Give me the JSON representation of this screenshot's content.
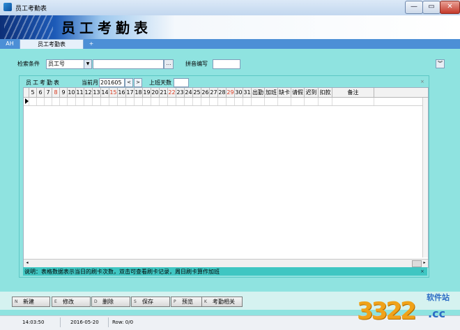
{
  "window": {
    "title": "员工考勤表",
    "min": "—",
    "max": "▭",
    "close": "✕"
  },
  "banner": {
    "title": "员工考勤表"
  },
  "tabs": [
    {
      "label": "AH"
    },
    {
      "label": "员工考勤表"
    },
    {
      "label": "+"
    }
  ],
  "search": {
    "condition_label": "检索条件",
    "field_value": "员工号",
    "field_arrow": "▼",
    "input_value": "",
    "browse_label": "…",
    "pinyin_label": "拼音编写",
    "pinyin_value": "",
    "collapse_label": "︾"
  },
  "attendance": {
    "header_label": "员工考勤表",
    "month_label": "当前月",
    "month_value": "201605",
    "prev_label": "<",
    "next_label": ">",
    "workdays_label": "上班天数",
    "workdays_value": "",
    "close_mark": "×"
  },
  "grid": {
    "columns": [
      {
        "label": ""
      },
      {
        "label": "5"
      },
      {
        "label": "6"
      },
      {
        "label": "7"
      },
      {
        "label": "8",
        "red": true
      },
      {
        "label": "9"
      },
      {
        "label": "10"
      },
      {
        "label": "11"
      },
      {
        "label": "12"
      },
      {
        "label": "13"
      },
      {
        "label": "14"
      },
      {
        "label": "15",
        "red": true
      },
      {
        "label": "16"
      },
      {
        "label": "17"
      },
      {
        "label": "18"
      },
      {
        "label": "19"
      },
      {
        "label": "20"
      },
      {
        "label": "21"
      },
      {
        "label": "22",
        "red": true
      },
      {
        "label": "23"
      },
      {
        "label": "24"
      },
      {
        "label": "25"
      },
      {
        "label": "26"
      },
      {
        "label": "27"
      },
      {
        "label": "28"
      },
      {
        "label": "29",
        "red": true
      },
      {
        "label": "30"
      },
      {
        "label": "31"
      },
      {
        "label": "出勤"
      },
      {
        "label": "加班"
      },
      {
        "label": "缺卡"
      },
      {
        "label": "请假"
      },
      {
        "label": "迟到"
      },
      {
        "label": "扣款"
      },
      {
        "label": "备注"
      }
    ],
    "hscroll_left": "◂",
    "hscroll_right": "▸"
  },
  "note": {
    "text": "说明：表格数据表示当日的刷卡次数，双击可查看刷卡记录，周日刷卡算作加班",
    "mark": "×"
  },
  "actions": [
    {
      "key": "N",
      "label": "新建"
    },
    {
      "key": "E",
      "label": "修改"
    },
    {
      "key": "D",
      "label": "删除"
    },
    {
      "key": "S",
      "label": "保存"
    },
    {
      "key": "P",
      "label": "预览"
    },
    {
      "key": "K",
      "label": "考勤相关"
    }
  ],
  "status": {
    "time": "14:03:50",
    "date": "2016-05-20",
    "row": "Row: 0/0"
  },
  "watermark": {
    "number": "3322",
    "site_cn": "软件站",
    "suffix": ".cc"
  },
  "colors": {
    "accent": "#4c8fd6",
    "panel": "#8fe3e0",
    "note": "#3fc6c2",
    "weekend": "#d6361b"
  }
}
